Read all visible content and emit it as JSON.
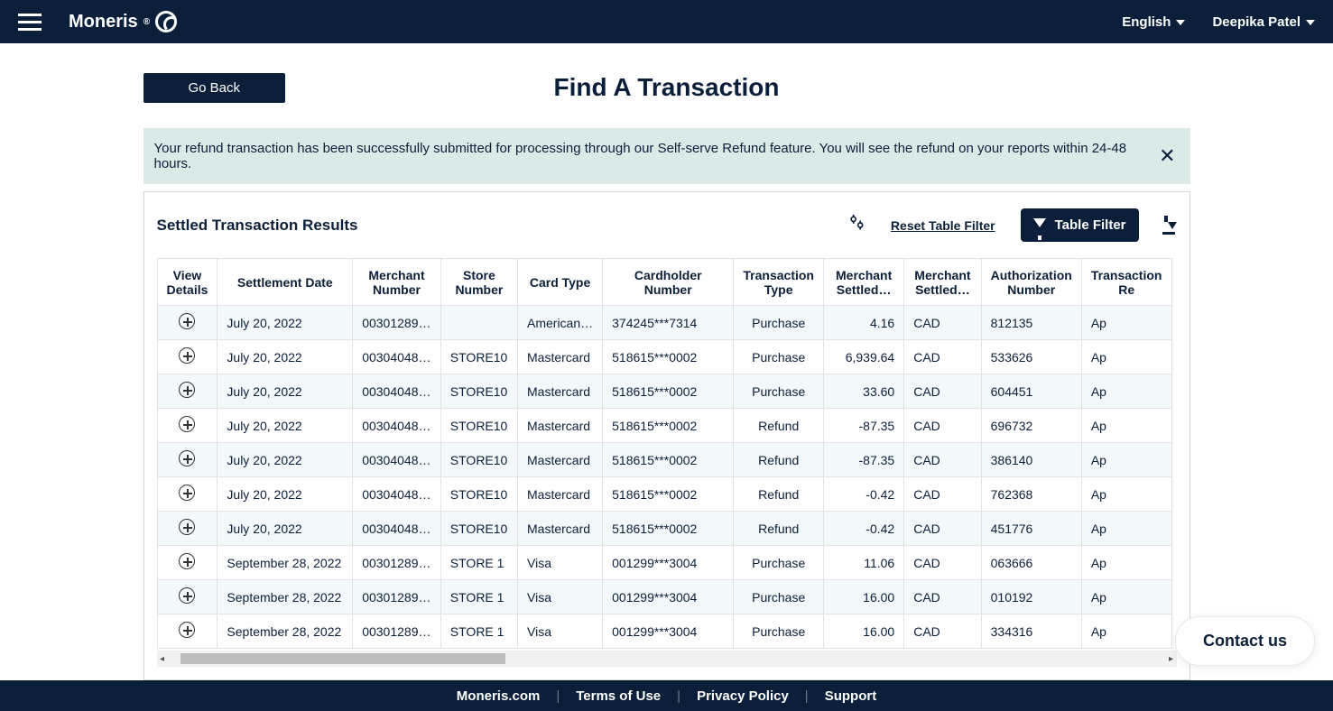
{
  "topbar": {
    "brand": "Moneris",
    "language_label": "English",
    "user_name": "Deepika Patel"
  },
  "header": {
    "goback": "Go Back",
    "title": "Find A Transaction"
  },
  "banner": {
    "message": "Your refund transaction has been successfully submitted for processing through our Self-serve Refund feature. You will see the refund on your reports within 24-48 hours."
  },
  "panel": {
    "title": "Settled Transaction Results",
    "reset_link": "Reset Table Filter",
    "filter_button": "Table Filter"
  },
  "table": {
    "headers": {
      "view": "View Details",
      "date": "Settlement Date",
      "merchant": "Merchant Number",
      "store": "Store Number",
      "card": "Card Type",
      "holder": "Cardholder Number",
      "ttype": "Transaction Type",
      "amt": "Merchant Settled…",
      "cur": "Merchant Settled…",
      "auth": "Authorization Number",
      "resp": "Transaction Re"
    },
    "rows": [
      {
        "date": "July 20, 2022",
        "merchant": "00301289…",
        "store": "",
        "card": "American…",
        "holder": "374245***7314",
        "ttype": "Purchase",
        "amt": "4.16",
        "cur": "CAD",
        "auth": "812135",
        "resp": "Ap"
      },
      {
        "date": "July 20, 2022",
        "merchant": "00304048…",
        "store": "STORE10",
        "card": "Mastercard",
        "holder": "518615***0002",
        "ttype": "Purchase",
        "amt": "6,939.64",
        "cur": "CAD",
        "auth": "533626",
        "resp": "Ap"
      },
      {
        "date": "July 20, 2022",
        "merchant": "00304048…",
        "store": "STORE10",
        "card": "Mastercard",
        "holder": "518615***0002",
        "ttype": "Purchase",
        "amt": "33.60",
        "cur": "CAD",
        "auth": "604451",
        "resp": "Ap"
      },
      {
        "date": "July 20, 2022",
        "merchant": "00304048…",
        "store": "STORE10",
        "card": "Mastercard",
        "holder": "518615***0002",
        "ttype": "Refund",
        "amt": "-87.35",
        "cur": "CAD",
        "auth": "696732",
        "resp": "Ap"
      },
      {
        "date": "July 20, 2022",
        "merchant": "00304048…",
        "store": "STORE10",
        "card": "Mastercard",
        "holder": "518615***0002",
        "ttype": "Refund",
        "amt": "-87.35",
        "cur": "CAD",
        "auth": "386140",
        "resp": "Ap"
      },
      {
        "date": "July 20, 2022",
        "merchant": "00304048…",
        "store": "STORE10",
        "card": "Mastercard",
        "holder": "518615***0002",
        "ttype": "Refund",
        "amt": "-0.42",
        "cur": "CAD",
        "auth": "762368",
        "resp": "Ap"
      },
      {
        "date": "July 20, 2022",
        "merchant": "00304048…",
        "store": "STORE10",
        "card": "Mastercard",
        "holder": "518615***0002",
        "ttype": "Refund",
        "amt": "-0.42",
        "cur": "CAD",
        "auth": "451776",
        "resp": "Ap"
      },
      {
        "date": "September 28, 2022",
        "merchant": "00301289…",
        "store": "STORE 1",
        "card": "Visa",
        "holder": "001299***3004",
        "ttype": "Purchase",
        "amt": "11.06",
        "cur": "CAD",
        "auth": "063666",
        "resp": "Ap"
      },
      {
        "date": "September 28, 2022",
        "merchant": "00301289…",
        "store": "STORE 1",
        "card": "Visa",
        "holder": "001299***3004",
        "ttype": "Purchase",
        "amt": "16.00",
        "cur": "CAD",
        "auth": "010192",
        "resp": "Ap"
      },
      {
        "date": "September 28, 2022",
        "merchant": "00301289…",
        "store": "STORE 1",
        "card": "Visa",
        "holder": "001299***3004",
        "ttype": "Purchase",
        "amt": "16.00",
        "cur": "CAD",
        "auth": "334316",
        "resp": "Ap"
      }
    ]
  },
  "footer": {
    "links": [
      "Moneris.com",
      "Terms of Use",
      "Privacy Policy",
      "Support"
    ]
  },
  "contact": "Contact us"
}
